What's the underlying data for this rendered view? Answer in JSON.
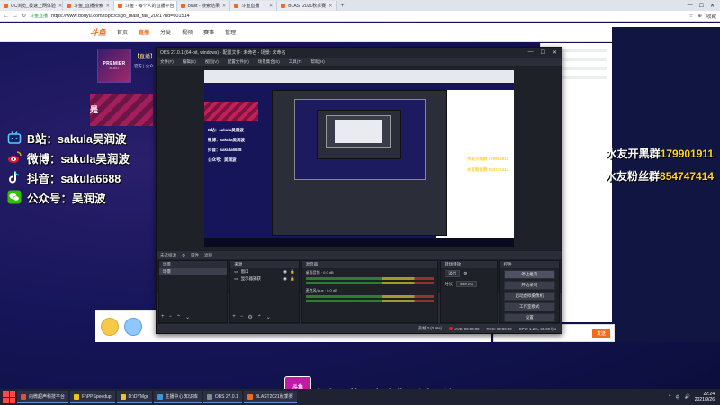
{
  "browser": {
    "tabs": [
      {
        "label": "UC浏览_极速上网体验",
        "active": false
      },
      {
        "label": "斗鱼_直播搜索",
        "active": false
      },
      {
        "label": "斗鱼 - 每个人的直播平台",
        "active": true
      },
      {
        "label": "blast - 搜索结果",
        "active": false
      },
      {
        "label": "斗鱼直播",
        "active": false
      },
      {
        "label": "BLAST2021秋季赛",
        "active": false
      }
    ],
    "new_tab": "+",
    "window_controls": [
      "—",
      "☐",
      "✕"
    ],
    "secure_label": "斗鱼直播",
    "url": "https://www.douyu.com/topic/csgo_blast_fall_2021?rid=601514",
    "right_items": [
      "☆",
      "⊕",
      "收藏"
    ]
  },
  "site": {
    "logo": "斗鱼",
    "nav": [
      {
        "label": "首页",
        "active": false
      },
      {
        "label": "直播",
        "active": true
      },
      {
        "label": "分类",
        "active": false
      },
      {
        "label": "视频",
        "active": false
      },
      {
        "label": "赛事",
        "active": false
      },
      {
        "label": "管理",
        "active": false
      }
    ],
    "room_title": "【直播】",
    "room_sub": "官方 | 公众",
    "avatar_label": "PREMIER",
    "avatar_sub": "BLAST",
    "stripe_text": "是"
  },
  "socials": [
    {
      "icon": "bilibili-icon",
      "text": "B站：sakula吴润波"
    },
    {
      "icon": "weibo-icon",
      "text": "微博：sakula吴润波"
    },
    {
      "icon": "tiktok-icon",
      "text": "抖音：sakula6688"
    },
    {
      "icon": "wechat-icon",
      "text": "公众号：吴润波"
    }
  ],
  "fans": [
    {
      "label": "水友开黑群",
      "value": "179901911"
    },
    {
      "label": "水友粉丝群",
      "value": "854747414"
    }
  ],
  "giftbar": {
    "meta": "主播ID 601514",
    "action": "发送"
  },
  "right_send": "发送",
  "obs": {
    "title": "OBS 27.0.1 (64-bit, windows) - 配置文件: 未命名 - 场景: 未命名",
    "menu": [
      "文件(F)",
      "编辑(E)",
      "视图(V)",
      "配置文件(P)",
      "场景集合(S)",
      "工具(T)",
      "帮助(H)"
    ],
    "mid_bar": [
      "未选择源",
      "属性",
      "滤镜"
    ],
    "mini_socials": [
      "B站：sakula吴润波",
      "微博：sakula吴润波",
      "抖音：sakula6688",
      "公众号：吴润波"
    ],
    "mini_fans": [
      "水友开黑群 179901911",
      "水友粉丝群 854747414"
    ],
    "docks": {
      "scenes": {
        "title": "场景",
        "items": [
          "场景"
        ]
      },
      "sources": {
        "title": "来源",
        "items": [
          "窗口",
          "显示器捕获"
        ]
      },
      "mixer": {
        "title": "混音器",
        "channels": [
          {
            "name": "桌面音频",
            "level": "0.0 dB"
          },
          {
            "name": "麦克风/Aux",
            "level": "0.0 dB"
          }
        ]
      },
      "transitions": {
        "title": "转场特效",
        "type": "淡出",
        "duration_label": "时长",
        "duration": "300 ms"
      },
      "controls": {
        "title": "控件",
        "buttons": [
          "停止推流",
          "开始录制",
          "启动虚拟摄像机",
          "工作室模式",
          "设置",
          "退出"
        ]
      }
    },
    "status": {
      "dropped": "丢帧 0 (0.0%)",
      "live": "LIVE: 00:00:00",
      "rec": "REC: 00:00:00",
      "cpu": "CPU: 1.2%, 30.00 fps"
    }
  },
  "caption": "点击屏幕下方头像悬浮下单",
  "caption_logo": "斗鱼",
  "taskbar": {
    "items": [
      {
        "label": "向微超声科技平台",
        "color": "#e74c3c"
      },
      {
        "label": "F:\\PPSpeedup",
        "color": "#f0c419"
      },
      {
        "label": "D:\\DYMgr",
        "color": "#f0c419"
      },
      {
        "label": "主播中心 知识库",
        "color": "#3498db"
      },
      {
        "label": "OBS 27.0.1",
        "color": "#7f8c8d"
      },
      {
        "label": "BLAST2021秋季赛",
        "color": "#f26b1d"
      }
    ],
    "time": "22:24",
    "date": "2021/9/26",
    "tray_icons": [
      "^",
      "中",
      "🔊"
    ]
  }
}
